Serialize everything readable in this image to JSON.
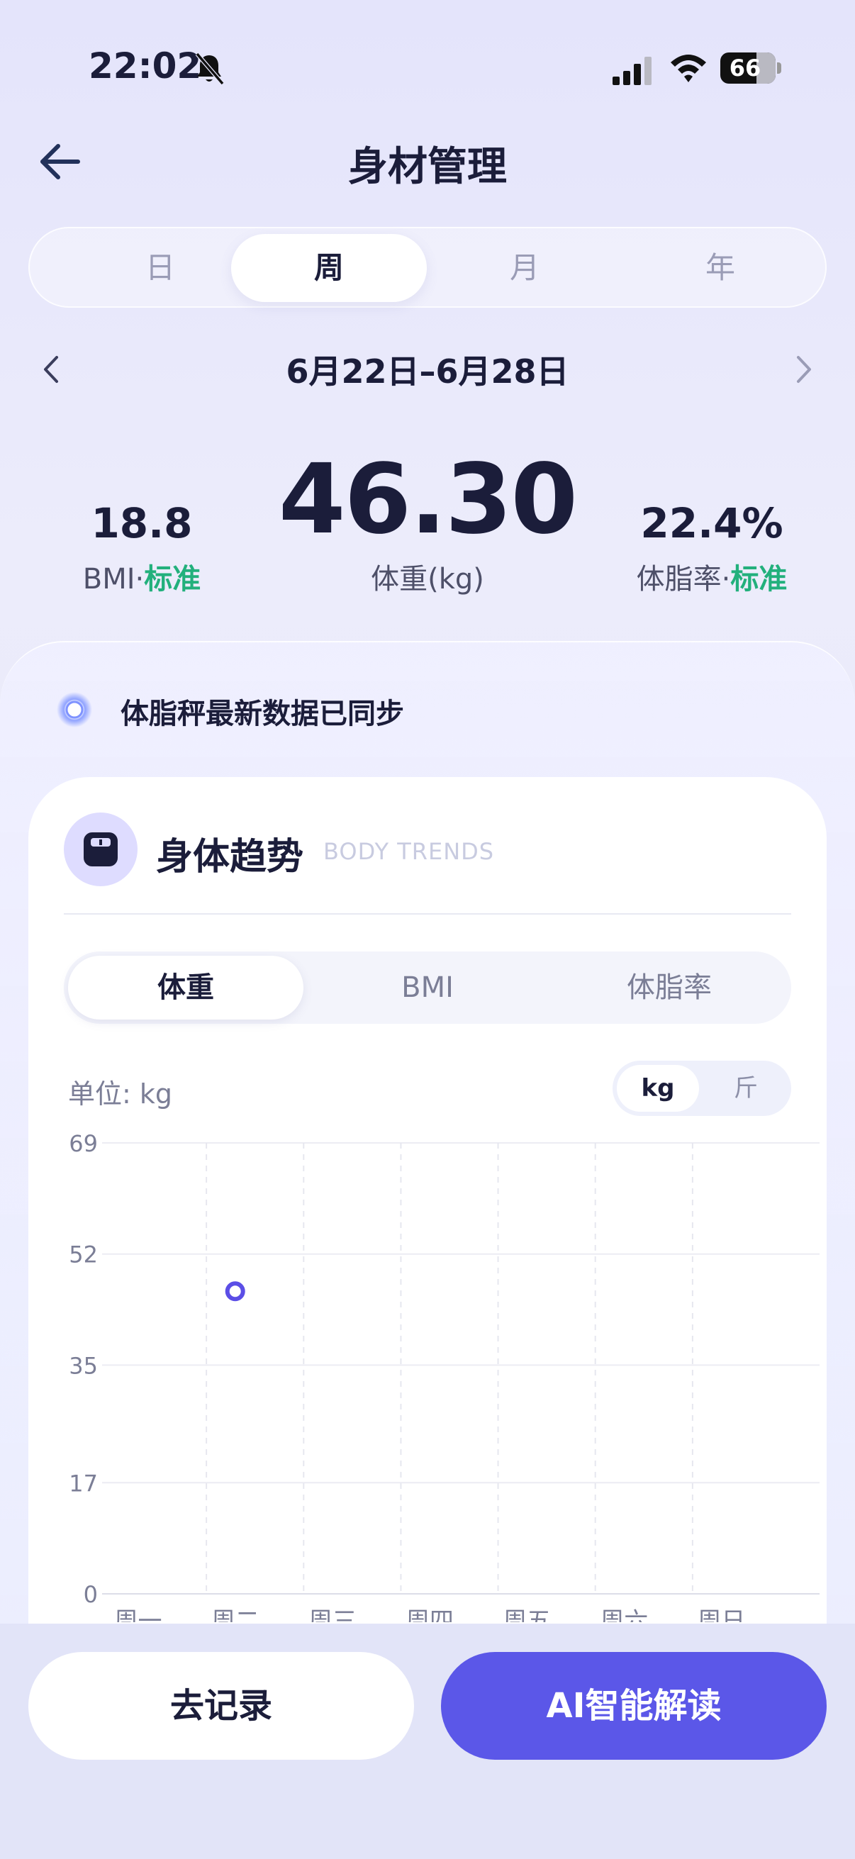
{
  "status_bar": {
    "time": "22:02",
    "battery": "66",
    "battery_level": 0.66
  },
  "header": {
    "title": "身材管理"
  },
  "period_tabs": {
    "items": [
      "日",
      "周",
      "月",
      "年"
    ],
    "active": "周"
  },
  "date_range": "6月22日–6月28日",
  "metrics": {
    "weight": {
      "value": "46.30",
      "label": "体重(kg)"
    },
    "bmi": {
      "value": "18.8",
      "label": "BMI",
      "status": "标准"
    },
    "body_fat": {
      "value": "22.4%",
      "label": "体脂率",
      "status": "标准"
    },
    "separator": "·"
  },
  "sync_text": "体脂秤最新数据已同步",
  "card": {
    "title": "身体趋势",
    "subtitle": "BODY TRENDS",
    "tabs": [
      "体重",
      "BMI",
      "体脂率"
    ],
    "active_tab": "体重",
    "unit_label": "单位: kg",
    "unit_options": [
      "kg",
      "斤"
    ],
    "active_unit": "kg"
  },
  "chart_data": {
    "type": "scatter",
    "categories": [
      "周一",
      "周二",
      "周三",
      "周四",
      "周五",
      "周六",
      "周日"
    ],
    "y_ticks": [
      0,
      17,
      35,
      52,
      69
    ],
    "ylim": [
      0,
      69
    ],
    "series": [
      {
        "values": [
          null,
          46.3,
          null,
          null,
          null,
          null,
          null
        ]
      }
    ],
    "colors": {
      "point": "#5b4ee6",
      "grid": "#ececf3",
      "tick": "#7b7e96"
    }
  },
  "buttons": {
    "record": "去记录",
    "ai": "AI智能解读"
  },
  "colors": {
    "accent": "#5b57e8",
    "ok": "#22b07c"
  }
}
